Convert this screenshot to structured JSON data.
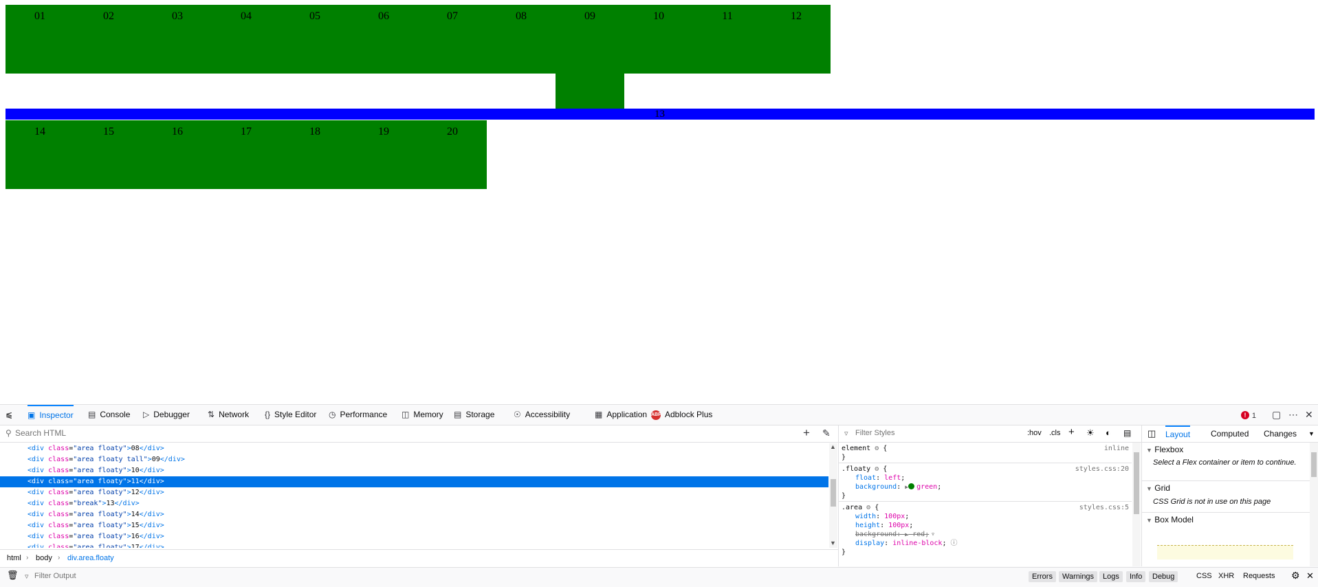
{
  "page": {
    "boxes_row1": [
      "01",
      "02",
      "03",
      "04",
      "05",
      "06",
      "07",
      "08",
      "09",
      "10",
      "11",
      "12"
    ],
    "break_label": "13",
    "boxes_row2": [
      "14",
      "15",
      "16",
      "17",
      "18",
      "19",
      "20"
    ]
  },
  "devtools": {
    "tabs": [
      "Inspector",
      "Console",
      "Debugger",
      "Network",
      "Style Editor",
      "Performance",
      "Memory",
      "Storage",
      "Accessibility",
      "Application",
      "Adblock Plus"
    ],
    "error_count": "1",
    "markup": {
      "search_placeholder": "Search HTML",
      "lines": [
        {
          "cls": "area floaty",
          "text": "08"
        },
        {
          "cls": "area floaty tall",
          "text": "09"
        },
        {
          "cls": "area floaty",
          "text": "10"
        },
        {
          "cls": "area floaty",
          "text": "11",
          "selected": true
        },
        {
          "cls": "area floaty",
          "text": "12"
        },
        {
          "cls": "break",
          "text": "13"
        },
        {
          "cls": "area floaty",
          "text": "14"
        },
        {
          "cls": "area floaty",
          "text": "15"
        },
        {
          "cls": "area floaty",
          "text": "16"
        },
        {
          "cls": "area floaty",
          "text": "17"
        }
      ],
      "breadcrumb": [
        "html",
        "body",
        "div.area.floaty"
      ]
    },
    "rules": {
      "filter_placeholder": "Filter Styles",
      "hov": ":hov",
      "cls": ".cls",
      "element_selector": "element",
      "element_source": "inline",
      "floaty_selector": ".floaty",
      "floaty_source": "styles.css:20",
      "floaty_props": [
        {
          "name": "float",
          "value": "left"
        },
        {
          "name": "background",
          "value": "green"
        }
      ],
      "area_selector": ".area",
      "area_source": "styles.css:5",
      "area_props": [
        {
          "name": "width",
          "value": "100px"
        },
        {
          "name": "height",
          "value": "100px"
        },
        {
          "name": "background",
          "value": "red"
        },
        {
          "name": "display",
          "value": "inline-block"
        }
      ]
    },
    "layout_panel": {
      "tabs": [
        "Layout",
        "Computed",
        "Changes"
      ],
      "flexbox_title": "Flexbox",
      "flexbox_msg": "Select a Flex container or item to continue.",
      "grid_title": "Grid",
      "grid_msg": "CSS Grid is not in use on this page",
      "boxmodel_title": "Box Model"
    },
    "console": {
      "filter_placeholder": "Filter Output",
      "levels": [
        "Errors",
        "Warnings",
        "Logs",
        "Info",
        "Debug"
      ],
      "types": [
        "CSS",
        "XHR",
        "Requests"
      ]
    }
  },
  "colors": {
    "float_box": "#008000",
    "break_bar": "#0000ff",
    "accent": "#0074e8"
  }
}
